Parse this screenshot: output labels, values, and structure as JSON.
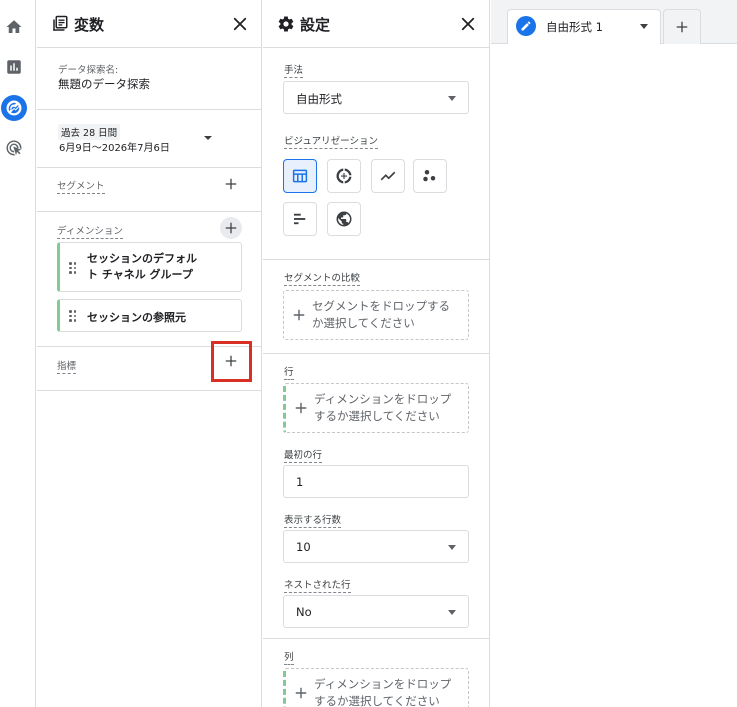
{
  "rail": {
    "items": [
      {
        "icon": "home-icon"
      },
      {
        "icon": "reports-icon"
      },
      {
        "icon": "explore-icon",
        "active": true
      },
      {
        "icon": "advertising-icon"
      }
    ]
  },
  "variables": {
    "title": "変数",
    "exploration_name_label": "データ探索名:",
    "exploration_name": "無題のデータ探索",
    "date_range_label": "過去 28 日間",
    "date_range_value": "6月9日～2026年7月6日",
    "segments_label": "セグメント",
    "dimensions_label": "ディメンション",
    "dimensions": [
      {
        "line1": "セッションのデフォル",
        "line2": "ト チャネル グループ"
      },
      {
        "line1": "セッションの参照元",
        "line2": ""
      }
    ],
    "metrics_label": "指標"
  },
  "settings": {
    "title": "設定",
    "technique_label": "手法",
    "technique_value": "自由形式",
    "visualization_label": "ビジュアリゼーション",
    "visualizations": [
      "table-icon",
      "donut-chart-icon",
      "line-chart-icon",
      "scatter-plot-icon",
      "bar-chart-icon",
      "geo-map-icon"
    ],
    "segment_compare_label": "セグメントの比較",
    "segment_drop": {
      "line1": "セグメントをドロップする",
      "line2": "か選択してください"
    },
    "rows_label": "行",
    "rows_drop": {
      "line1": "ディメンションをドロップ",
      "line2": "するか選択してください"
    },
    "first_row_label": "最初の行",
    "first_row_value": "1",
    "rows_to_show_label": "表示する行数",
    "rows_to_show_value": "10",
    "nested_rows_label": "ネストされた行",
    "nested_rows_value": "No",
    "columns_label": "列",
    "columns_drop": {
      "line1": "ディメンションをドロップ",
      "line2": "するか選択してください"
    }
  },
  "tabs": [
    {
      "label": "自由形式 1"
    }
  ],
  "colors": {
    "accent": "#1a73e8",
    "highlight": "#d93025",
    "chip_border": "#81c995"
  }
}
